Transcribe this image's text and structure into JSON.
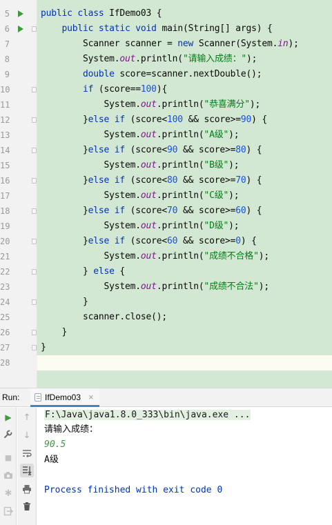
{
  "editor": {
    "lines": [
      {
        "n": "5",
        "run": true,
        "fold": false,
        "t": [
          [
            "kw",
            "public class "
          ],
          [
            "p",
            "IfDemo03 {"
          ]
        ]
      },
      {
        "n": "6",
        "run": true,
        "fold": true,
        "t": [
          [
            "p",
            "    "
          ],
          [
            "kw",
            "public static void "
          ],
          [
            "p",
            "main(String[] args) {"
          ]
        ]
      },
      {
        "n": "7",
        "t": [
          [
            "p",
            "        Scanner scanner = "
          ],
          [
            "kw",
            "new "
          ],
          [
            "p",
            "Scanner(System."
          ],
          [
            "fld",
            "in"
          ],
          [
            "p",
            ");"
          ]
        ]
      },
      {
        "n": "8",
        "t": [
          [
            "p",
            "        System."
          ],
          [
            "fld",
            "out"
          ],
          [
            "p",
            ".println("
          ],
          [
            "str",
            "\"请输入成绩：\""
          ],
          [
            "p",
            ");"
          ]
        ]
      },
      {
        "n": "9",
        "t": [
          [
            "p",
            "        "
          ],
          [
            "kw",
            "double "
          ],
          [
            "p",
            "score=scanner.nextDouble();"
          ]
        ]
      },
      {
        "n": "10",
        "fold": true,
        "t": [
          [
            "p",
            "        "
          ],
          [
            "kw",
            "if "
          ],
          [
            "p",
            "(score=="
          ],
          [
            "num",
            "100"
          ],
          [
            "p",
            "){"
          ]
        ]
      },
      {
        "n": "11",
        "t": [
          [
            "p",
            "            System."
          ],
          [
            "fld",
            "out"
          ],
          [
            "p",
            ".println("
          ],
          [
            "str",
            "\"恭喜满分\""
          ],
          [
            "p",
            ");"
          ]
        ]
      },
      {
        "n": "12",
        "fold": true,
        "t": [
          [
            "p",
            "        }"
          ],
          [
            "kw",
            "else if "
          ],
          [
            "p",
            "(score<"
          ],
          [
            "num",
            "100"
          ],
          [
            "p",
            " && score>="
          ],
          [
            "num",
            "90"
          ],
          [
            "p",
            ") {"
          ]
        ]
      },
      {
        "n": "13",
        "t": [
          [
            "p",
            "            System."
          ],
          [
            "fld",
            "out"
          ],
          [
            "p",
            ".println("
          ],
          [
            "str",
            "\"A级\""
          ],
          [
            "p",
            ");"
          ]
        ]
      },
      {
        "n": "14",
        "fold": true,
        "t": [
          [
            "p",
            "        }"
          ],
          [
            "kw",
            "else if "
          ],
          [
            "p",
            "(score<"
          ],
          [
            "num",
            "90"
          ],
          [
            "p",
            " && score>="
          ],
          [
            "num",
            "80"
          ],
          [
            "p",
            ") {"
          ]
        ]
      },
      {
        "n": "15",
        "t": [
          [
            "p",
            "            System."
          ],
          [
            "fld",
            "out"
          ],
          [
            "p",
            ".println("
          ],
          [
            "str",
            "\"B级\""
          ],
          [
            "p",
            ");"
          ]
        ]
      },
      {
        "n": "16",
        "fold": true,
        "t": [
          [
            "p",
            "        }"
          ],
          [
            "kw",
            "else if "
          ],
          [
            "p",
            "(score<"
          ],
          [
            "num",
            "80"
          ],
          [
            "p",
            " && score>="
          ],
          [
            "num",
            "70"
          ],
          [
            "p",
            ") {"
          ]
        ]
      },
      {
        "n": "17",
        "t": [
          [
            "p",
            "            System."
          ],
          [
            "fld",
            "out"
          ],
          [
            "p",
            ".println("
          ],
          [
            "str",
            "\"C级\""
          ],
          [
            "p",
            ");"
          ]
        ]
      },
      {
        "n": "18",
        "fold": true,
        "t": [
          [
            "p",
            "        }"
          ],
          [
            "kw",
            "else if "
          ],
          [
            "p",
            "(score<"
          ],
          [
            "num",
            "70"
          ],
          [
            "p",
            " && score>="
          ],
          [
            "num",
            "60"
          ],
          [
            "p",
            ") {"
          ]
        ]
      },
      {
        "n": "19",
        "t": [
          [
            "p",
            "            System."
          ],
          [
            "fld",
            "out"
          ],
          [
            "p",
            ".println("
          ],
          [
            "str",
            "\"D级\""
          ],
          [
            "p",
            ");"
          ]
        ]
      },
      {
        "n": "20",
        "fold": true,
        "t": [
          [
            "p",
            "        }"
          ],
          [
            "kw",
            "else if "
          ],
          [
            "p",
            "(score<"
          ],
          [
            "num",
            "60"
          ],
          [
            "p",
            " && score>="
          ],
          [
            "num",
            "0"
          ],
          [
            "p",
            ") {"
          ]
        ]
      },
      {
        "n": "21",
        "t": [
          [
            "p",
            "            System."
          ],
          [
            "fld",
            "out"
          ],
          [
            "p",
            ".println("
          ],
          [
            "str",
            "\"成绩不合格\""
          ],
          [
            "p",
            ");"
          ]
        ]
      },
      {
        "n": "22",
        "fold": true,
        "t": [
          [
            "p",
            "        } "
          ],
          [
            "kw",
            "else "
          ],
          [
            "p",
            "{"
          ]
        ]
      },
      {
        "n": "23",
        "t": [
          [
            "p",
            "            System."
          ],
          [
            "fld",
            "out"
          ],
          [
            "p",
            ".println("
          ],
          [
            "str",
            "\"成绩不合法\""
          ],
          [
            "p",
            ");"
          ]
        ]
      },
      {
        "n": "24",
        "fold": true,
        "t": [
          [
            "p",
            "        }"
          ]
        ]
      },
      {
        "n": "25",
        "t": [
          [
            "p",
            "        scanner.close();"
          ]
        ]
      },
      {
        "n": "26",
        "fold": true,
        "t": [
          [
            "p",
            "    }"
          ]
        ]
      },
      {
        "n": "27",
        "fold": true,
        "t": [
          [
            "p",
            "}"
          ]
        ]
      },
      {
        "n": "28",
        "t": []
      }
    ]
  },
  "run_panel": {
    "label": "Run:",
    "tab_label": "IfDemo03",
    "tab_close": "×",
    "console": {
      "command": "F:\\Java\\java1.8.0_333\\bin\\java.exe ...",
      "prompt": "请输入成绩：",
      "input": "90.5",
      "result": "A级",
      "finished": "Process finished with exit code 0"
    }
  },
  "toolbar": {
    "rerun": "▶",
    "settings": "🔧",
    "stop": "■",
    "camera": "📷",
    "pin": "✱",
    "exit": "⇥",
    "up": "↑",
    "down": "↓",
    "soft_wrap": "⇋",
    "scroll_end": "⭳",
    "print": "⎙",
    "trash": "🗑"
  },
  "colors": {
    "keyword": "#0033b3",
    "field": "#871094",
    "number": "#1750eb",
    "string": "#067d17",
    "run_green": "#3d9b3d"
  }
}
